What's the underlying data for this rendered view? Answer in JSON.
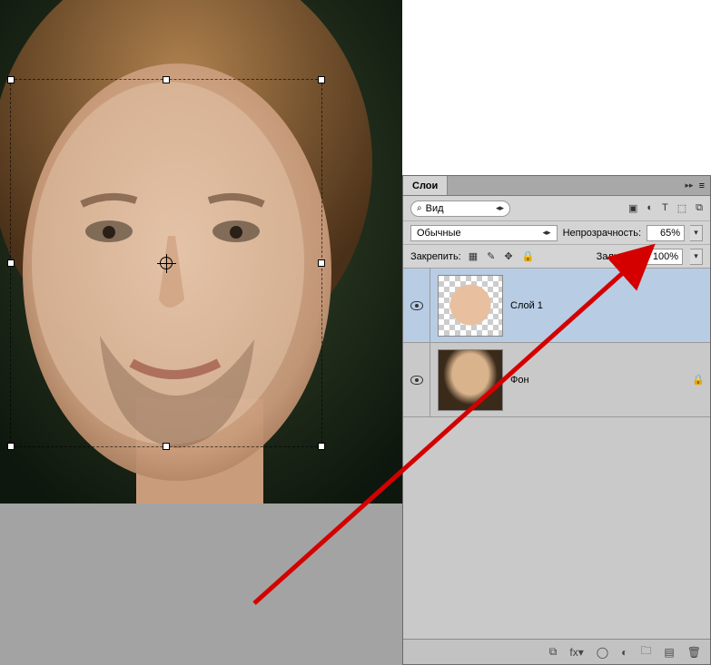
{
  "panel": {
    "title": "Слои",
    "filter_label": "Вид",
    "blend_mode": "Обычные",
    "opacity_label": "Непрозрачность:",
    "opacity_value": "65%",
    "lock_label": "Закрепить:",
    "fill_label": "Заливка:",
    "fill_value": "100%"
  },
  "layers": [
    {
      "name": "Слой 1",
      "locked": false,
      "selected": true
    },
    {
      "name": "Фон",
      "locked": true,
      "selected": false
    }
  ],
  "icons": {
    "search": "⌕",
    "image": "▣",
    "adjust": "◐",
    "type": "T",
    "shape": "⬚",
    "smart": "⧉",
    "menu": "≡",
    "collapse": "▸▸",
    "transparency": "▦",
    "brush": "✎",
    "move": "✥",
    "lock": "🔒",
    "link": "⧉",
    "fx": "fx▾",
    "mask": "◯",
    "adjustlayer": "◐",
    "folder": "🗀",
    "new": "▤",
    "trash": "🗑",
    "chevron": "▾",
    "chevrons": "◂▸"
  }
}
